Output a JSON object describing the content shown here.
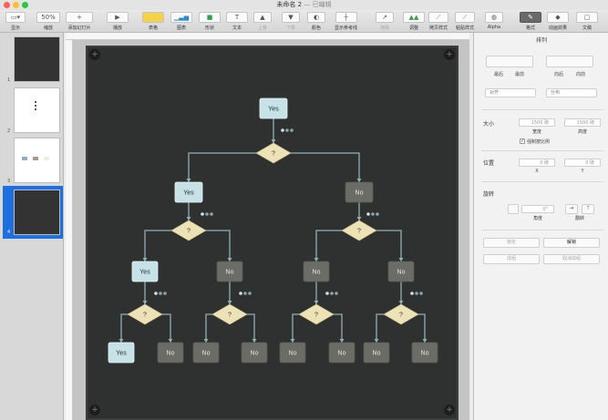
{
  "window": {
    "title": "未命名 2",
    "status": "— 已编辑"
  },
  "toolbar": {
    "view": "显示",
    "zoom_value": "50%",
    "zoom": "缩放",
    "add_slide": "添加幻灯片",
    "play": "播放",
    "table": "表格",
    "chart": "图表",
    "shape": "形状",
    "text": "文本",
    "forward": "上移",
    "backward": "下移",
    "color": "颜色",
    "guides": "显示参考线",
    "connect": "连接",
    "adjust": "调整",
    "copy_style": "拷贝样式",
    "paste_style": "粘贴样式",
    "alpha": "Alpha",
    "format": "格式",
    "animate": "动画效果",
    "document": "文稿"
  },
  "slides": [
    "1",
    "2",
    "3",
    "4"
  ],
  "inspector": {
    "title": "排列",
    "back": "最后",
    "backward": "最前",
    "forward": "向后",
    "front": "向前",
    "align": "对齐",
    "distribute": "分布",
    "size": "大小",
    "width": "1500 磅",
    "height": "1500 磅",
    "width_label": "宽度",
    "height_label": "高度",
    "constrain": "强制按比例",
    "position": "位置",
    "x": "0 磅",
    "y": "0 磅",
    "x_label": "X",
    "y_label": "Y",
    "rotate": "旋转",
    "angle": "0°",
    "angle_label": "角度",
    "flip_label": "翻转",
    "lock": "锁定",
    "unlock": "解锁",
    "group": "成组",
    "ungroup": "取消成组"
  },
  "flowchart": {
    "decision": "?",
    "yes": "Yes",
    "no": "No",
    "colors": {
      "yes_fill": "#c6e2e6",
      "no_fill": "#6b6c66",
      "decision_fill": "#ede1b6",
      "line": "#8fb0b8",
      "board": "#2f3030"
    }
  }
}
